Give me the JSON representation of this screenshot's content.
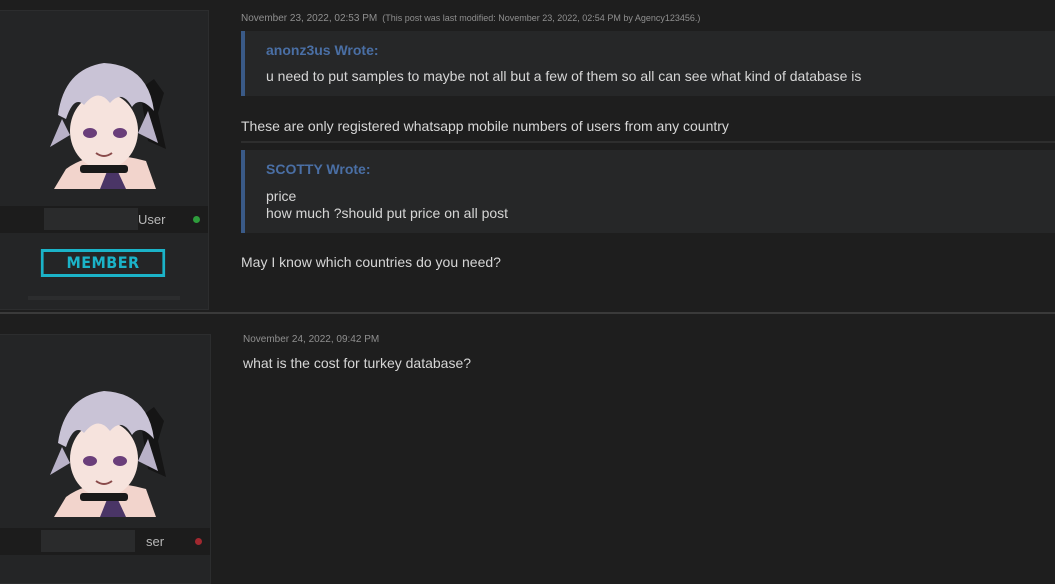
{
  "posts": [
    {
      "username_suffix": "User",
      "rank": "MEMBER",
      "status_color": "#2e9c3c",
      "timestamp": "November 23, 2022, 02:53 PM",
      "edit_note": "(This post was last modified: November 23, 2022, 02:54 PM by Agency123456.)",
      "quotes": [
        {
          "author": "anonz3us Wrote:",
          "lines": [
            "u need to put samples to maybe not all but a few of them so all can see what kind of database is"
          ]
        },
        {
          "author": "SCOTTY Wrote:",
          "lines": [
            "price",
            "how much ?should put price on all post"
          ]
        }
      ],
      "messages": [
        "These are only registered whatsapp mobile numbers of users from any country",
        "May I know which countries do you need?"
      ]
    },
    {
      "username_suffix": "ser",
      "status_color": "#a1282f",
      "timestamp": "November 24, 2022, 09:42 PM",
      "messages": [
        "what is the cost for turkey database?"
      ]
    }
  ],
  "colors": {
    "accent_rank": "#1bb3c8",
    "quote_border": "#3a5a87",
    "quote_author": "#4a6fa5",
    "online": "#2e9c3c",
    "offline": "#a1282f"
  }
}
